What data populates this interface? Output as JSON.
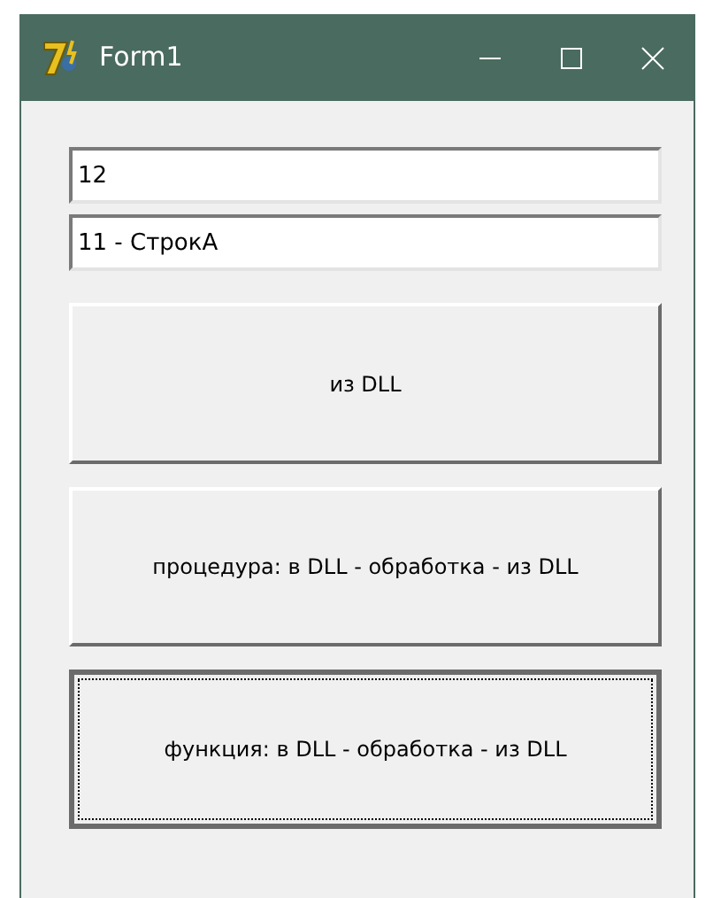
{
  "window": {
    "title": "Form1"
  },
  "fields": [
    {
      "value": "12"
    },
    {
      "value": "11 - СтрокА"
    }
  ],
  "buttons": [
    {
      "label": "из DLL",
      "focused": false
    },
    {
      "label": "процедура: в DLL - обработка - из DLL",
      "focused": false
    },
    {
      "label": "функция: в DLL - обработка - из DLL",
      "focused": true
    }
  ]
}
